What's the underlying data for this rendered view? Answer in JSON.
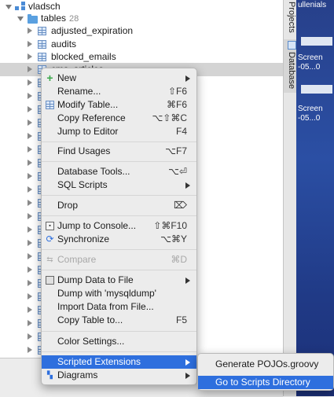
{
  "tree": {
    "schema": {
      "label": "vladsch"
    },
    "tables_folder": {
      "label": "tables",
      "count": "28"
    },
    "items": [
      {
        "label": "adjusted_expiration"
      },
      {
        "label": "audits"
      },
      {
        "label": "blocked_emails"
      },
      {
        "label": "cms_articles"
      }
    ]
  },
  "tool_strip": {
    "projects_label": "Projects",
    "database_label": "Database"
  },
  "desktop": {
    "lines": [
      {
        "text": "ullenials"
      },
      {
        "text": "Screen"
      },
      {
        "text": "-05...0"
      },
      {
        "text": "Screen"
      },
      {
        "text": "-05...0"
      }
    ]
  },
  "context_menu": {
    "items": [
      {
        "id": "new",
        "label": "New",
        "submenu": true,
        "icon": "plus-icon"
      },
      {
        "id": "rename",
        "label": "Rename...",
        "shortcut": "⇧F6"
      },
      {
        "id": "modify_table",
        "label": "Modify Table...",
        "shortcut": "⌘F6",
        "icon": "table-icon"
      },
      {
        "id": "copy_reference",
        "label": "Copy Reference",
        "shortcut": "⌥⇧⌘C"
      },
      {
        "id": "jump_to_editor",
        "label": "Jump to Editor",
        "shortcut": "F4"
      },
      {
        "id": "find_usages",
        "label": "Find Usages",
        "shortcut": "⌥F7"
      },
      {
        "id": "database_tools",
        "label": "Database Tools...",
        "shortcut": "⌥⏎"
      },
      {
        "id": "sql_scripts",
        "label": "SQL Scripts",
        "submenu": true
      },
      {
        "id": "drop",
        "label": "Drop",
        "shortcut": "⌦"
      },
      {
        "id": "jump_to_console",
        "label": "Jump to Console...",
        "shortcut": "⇧⌘F10",
        "icon": "console-icon"
      },
      {
        "id": "synchronize",
        "label": "Synchronize",
        "shortcut": "⌥⌘Y",
        "icon": "sync-icon"
      },
      {
        "id": "compare",
        "label": "Compare",
        "shortcut": "⌘D",
        "disabled": true,
        "icon": "compare-icon"
      },
      {
        "id": "dump_data_to_file",
        "label": "Dump Data to File",
        "submenu": true,
        "icon": "dump-icon"
      },
      {
        "id": "dump_mysqldump",
        "label": "Dump with 'mysqldump'"
      },
      {
        "id": "import_data",
        "label": "Import Data from File..."
      },
      {
        "id": "copy_table_to",
        "label": "Copy Table to...",
        "shortcut": "F5"
      },
      {
        "id": "color_settings",
        "label": "Color Settings..."
      },
      {
        "id": "scripted_extensions",
        "label": "Scripted Extensions",
        "submenu": true,
        "highlighted": true
      },
      {
        "id": "diagrams",
        "label": "Diagrams",
        "submenu": true,
        "icon": "diagram-icon"
      }
    ]
  },
  "submenu": {
    "items": [
      {
        "label": "Generate POJOs.groovy"
      },
      {
        "label": "Go to Scripts Directory",
        "highlighted": true
      }
    ]
  },
  "colors": {
    "highlight": "#2e6fde",
    "menu_bg": "#ececec",
    "selection_row": "#d4d4d4"
  }
}
